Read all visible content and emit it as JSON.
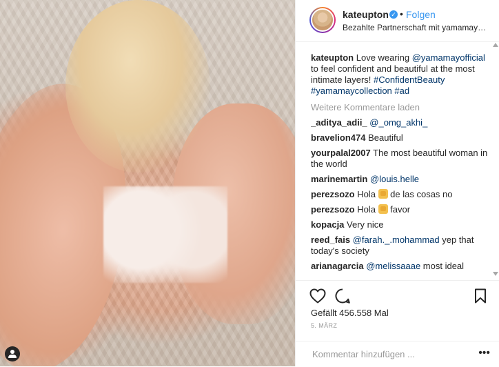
{
  "post": {
    "username": "kateupton",
    "verified_icon": "verified-badge-icon",
    "follow_label": "Folgen",
    "separator": "•",
    "partnership": "Bezahlte Partnerschaft mit yamamayof...",
    "caption": {
      "user": "kateupton",
      "text1": " Love wearing ",
      "mention": "@yamamayofficial",
      "text2": " to feel confident and beautiful at the most intimate layers! ",
      "hashtags": "#ConfidentBeauty #yamamaycollection #ad"
    },
    "load_more": "Weitere Kommentare laden",
    "comments": [
      {
        "user": "_aditya_adii_",
        "mention": "@_omg_akhi_",
        "text": ""
      },
      {
        "user": "bravelion474",
        "mention": "",
        "text": " Beautiful"
      },
      {
        "user": "yourpalal2007",
        "mention": "",
        "text": " The most beautiful woman in the world"
      },
      {
        "user": "marinemartin",
        "mention": "@louis.helle",
        "text": ""
      },
      {
        "user": "perezsozo",
        "mention": "",
        "text_before": " Hola ",
        "text_after": " de las cosas no"
      },
      {
        "user": "perezsozo",
        "mention": "",
        "text_before": " Hola ",
        "text_after": " favor"
      },
      {
        "user": "kopacja",
        "mention": "",
        "text": " Very nice"
      },
      {
        "user": "reed_fais",
        "mention": "@farah._.mohammad",
        "text": " yep that today's society"
      },
      {
        "user": "arianagarcia",
        "mention": "@melissaaae",
        "text": " most ideal"
      }
    ],
    "likes": "Gefällt 456.558 Mal",
    "date": "5. MÄRZ",
    "comment_placeholder": "Kommentar hinzufügen ...",
    "more_icon": "•••"
  },
  "icons": {
    "like": "heart-icon",
    "comment": "comment-bubble-icon",
    "save": "bookmark-icon",
    "user_tag": "user-tag-icon"
  },
  "colors": {
    "link": "#003569",
    "accent": "#3897f0",
    "muted": "#999999"
  }
}
